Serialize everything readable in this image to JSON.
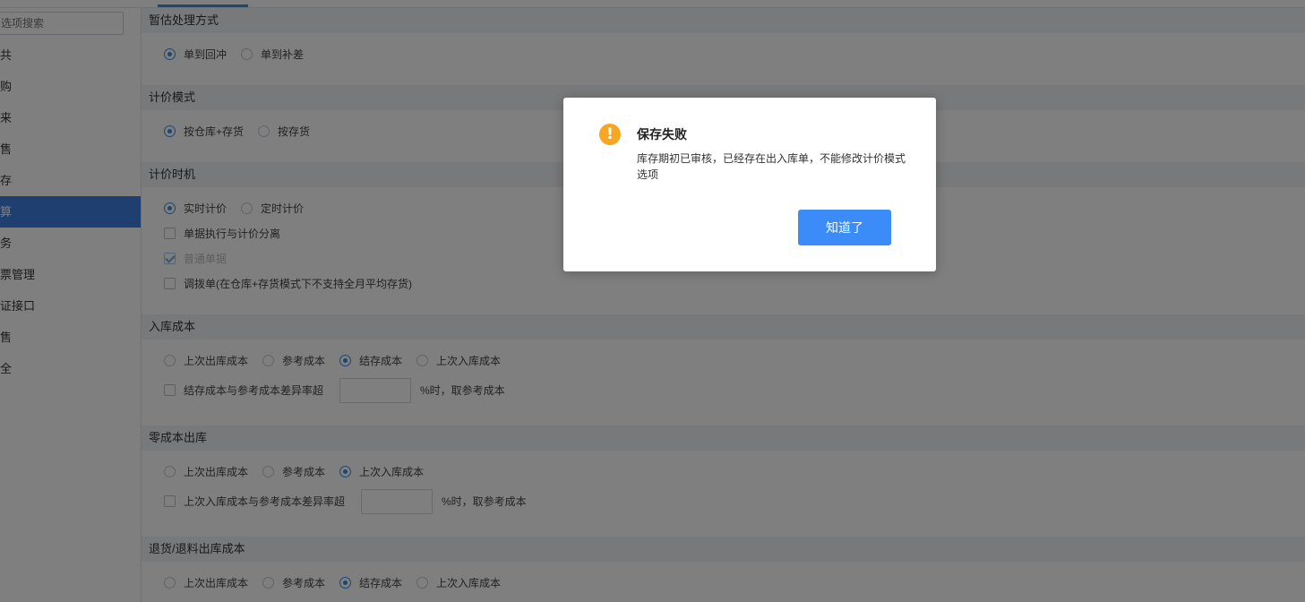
{
  "sidebar": {
    "search_placeholder": "选项搜索",
    "items": [
      "共",
      "购",
      "来",
      "售",
      "存",
      "算",
      "务",
      "票管理",
      "证接口",
      "售",
      "全"
    ],
    "active_index": 5
  },
  "sections": [
    {
      "title": "暂估处理方式",
      "options": [
        "单到回冲",
        "单到补差"
      ]
    },
    {
      "title": "计价模式",
      "options": [
        "按仓库+存货",
        "按存货"
      ]
    },
    {
      "title": "计价时机",
      "options": [
        "实时计价",
        "定时计价"
      ],
      "checkboxes": [
        "单据执行与计价分离",
        "普通单据",
        "调拨单(在仓库+存货模式下不支持全月平均存货)"
      ]
    },
    {
      "title": "入库成本",
      "options": [
        "上次出库成本",
        "参考成本",
        "结存成本",
        "上次入库成本"
      ],
      "threshold_label": "结存成本与参考成本差异率超",
      "threshold_suffix": "%时，取参考成本"
    },
    {
      "title": "零成本出库",
      "options": [
        "上次出库成本",
        "参考成本",
        "上次入库成本"
      ],
      "threshold_label": "上次入库成本与参考成本差异率超",
      "threshold_suffix": "%时，取参考成本"
    },
    {
      "title": "退货/退料出库成本",
      "options": [
        "上次出库成本",
        "参考成本",
        "结存成本",
        "上次入库成本"
      ]
    }
  ],
  "dialog": {
    "title": "保存失败",
    "message": "库存期初已审核，已经存在出入库单，不能修改计价模式选项",
    "button_label": "知道了",
    "icon": "warning-icon",
    "icon_glyph": "!",
    "icon_color": "#f5a623",
    "accent_color": "#3b8cf8"
  }
}
